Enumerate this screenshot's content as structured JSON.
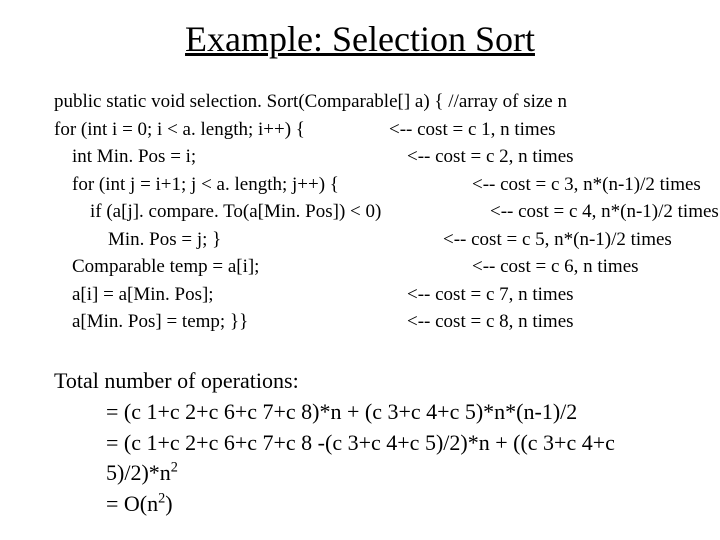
{
  "title": "Example: Selection Sort",
  "code": {
    "l0": {
      "text": "public static void selection. Sort(Comparable[] a) { //array of size n",
      "note": ""
    },
    "l1": {
      "text": "for (int i = 0; i < a. length; i++) {",
      "note": "<-- cost = c 1, n times"
    },
    "l2": {
      "text": "int Min. Pos = i;",
      "note": "<-- cost = c 2, n times"
    },
    "l3": {
      "text": "for (int j = i+1; j < a. length; j++) {",
      "note": "<-- cost = c 3, n*(n-1)/2 times"
    },
    "l4": {
      "text": "if (a[j]. compare. To(a[Min. Pos]) < 0)",
      "note": "<-- cost = c 4, n*(n-1)/2 times"
    },
    "l5": {
      "text": "Min. Pos = j; }",
      "note": "<-- cost = c 5, n*(n-1)/2 times"
    },
    "l6": {
      "text": "Comparable temp = a[i];",
      "note": "<-- cost = c 6, n times"
    },
    "l7": {
      "text": "a[i] = a[Min. Pos];",
      "note": "<-- cost = c 7, n times"
    },
    "l8": {
      "text": "a[Min. Pos] = temp; }}",
      "note": "<-- cost = c 8, n times"
    }
  },
  "summary": {
    "heading": "Total number of operations:",
    "eq1": "= (c 1+c 2+c 6+c 7+c 8)*n + (c 3+c 4+c 5)*n*(n-1)/2",
    "eq2_a": "= (c 1+c 2+c 6+c 7+c 8 -(c 3+c 4+c 5)/2)*n + ((c 3+c 4+c 5)/2)*n",
    "eq2_sup": "2",
    "eq3_a": "= O(n",
    "eq3_sup": "2",
    "eq3_b": ")"
  }
}
